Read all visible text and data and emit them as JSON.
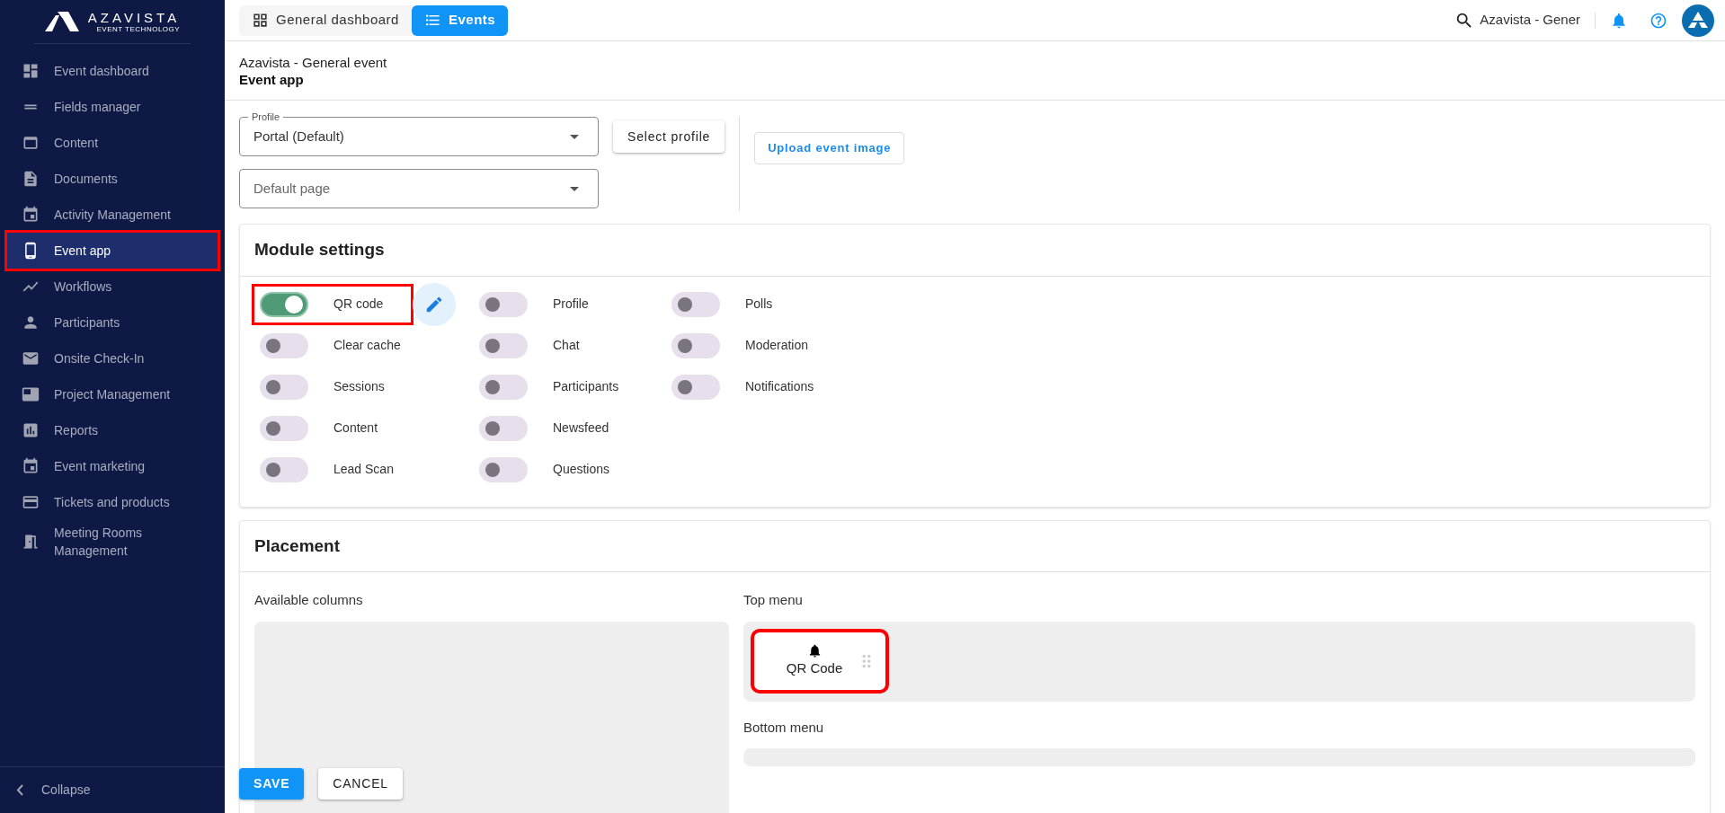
{
  "sidebar": {
    "logo": {
      "name": "AZAVISTA",
      "tagline": "EVENT TECHNOLOGY"
    },
    "items": [
      {
        "label": "Event dashboard",
        "selected": false,
        "highlighted": false
      },
      {
        "label": "Fields manager",
        "selected": false,
        "highlighted": false
      },
      {
        "label": "Content",
        "selected": false,
        "highlighted": false
      },
      {
        "label": "Documents",
        "selected": false,
        "highlighted": false
      },
      {
        "label": "Activity Management",
        "selected": false,
        "highlighted": false
      },
      {
        "label": "Event app",
        "selected": true,
        "highlighted": true
      },
      {
        "label": "Workflows",
        "selected": false,
        "highlighted": false
      },
      {
        "label": "Participants",
        "selected": false,
        "highlighted": false
      },
      {
        "label": "Onsite Check-In",
        "selected": false,
        "highlighted": false
      },
      {
        "label": "Project Management",
        "selected": false,
        "highlighted": false
      },
      {
        "label": "Reports",
        "selected": false,
        "highlighted": false
      },
      {
        "label": "Event marketing",
        "selected": false,
        "highlighted": false
      },
      {
        "label": "Tickets and products",
        "selected": false,
        "highlighted": false
      },
      {
        "label": "Meeting Rooms Management",
        "selected": false,
        "highlighted": false
      }
    ],
    "collapse": "Collapse"
  },
  "header": {
    "tabs": [
      {
        "label": "General dashboard",
        "selected": false
      },
      {
        "label": "Events",
        "selected": true
      }
    ],
    "search_value": "Azavista - Gener"
  },
  "page": {
    "event": "Azavista - General event",
    "title": "Event app"
  },
  "profile": {
    "label": "Profile",
    "value": "Portal (Default)",
    "page_placeholder": "Default page",
    "select_button": "Select profile",
    "upload_button": "Upload event image"
  },
  "module_settings": {
    "title": "Module settings",
    "columns": [
      {
        "items": [
          {
            "label": "QR code",
            "on": true,
            "highlighted": true,
            "editable": true
          },
          {
            "label": "Clear cache",
            "on": false,
            "highlighted": false,
            "editable": false
          },
          {
            "label": "Sessions",
            "on": false,
            "highlighted": false,
            "editable": false
          },
          {
            "label": "Content",
            "on": false,
            "highlighted": false,
            "editable": false
          },
          {
            "label": "Lead Scan",
            "on": false,
            "highlighted": false,
            "editable": false
          }
        ]
      },
      {
        "items": [
          {
            "label": "Profile",
            "on": false,
            "highlighted": false,
            "editable": false
          },
          {
            "label": "Chat",
            "on": false,
            "highlighted": false,
            "editable": false
          },
          {
            "label": "Participants",
            "on": false,
            "highlighted": false,
            "editable": false
          },
          {
            "label": "Newsfeed",
            "on": false,
            "highlighted": false,
            "editable": false
          },
          {
            "label": "Questions",
            "on": false,
            "highlighted": false,
            "editable": false
          }
        ]
      },
      {
        "items": [
          {
            "label": "Polls",
            "on": false,
            "highlighted": false,
            "editable": false
          },
          {
            "label": "Moderation",
            "on": false,
            "highlighted": false,
            "editable": false
          },
          {
            "label": "Notifications",
            "on": false,
            "highlighted": false,
            "editable": false
          }
        ]
      }
    ]
  },
  "placement": {
    "title": "Placement",
    "available_label": "Available columns",
    "top_menu_label": "Top menu",
    "top_menu": [
      {
        "label": "QR Code",
        "highlighted": true
      }
    ],
    "bottom_menu_label": "Bottom menu"
  },
  "actions": {
    "save": "SAVE",
    "cancel": "CANCEL"
  }
}
